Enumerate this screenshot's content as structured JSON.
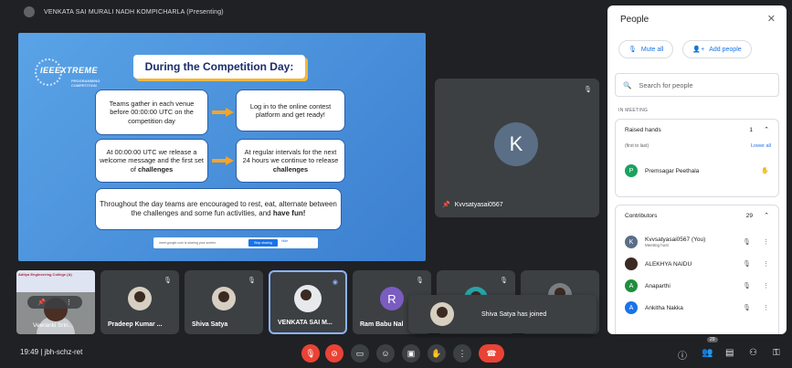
{
  "presenter_bar": {
    "text": "VENKATA SAI MURALI NADH KOMPICHARLA (Presenting)"
  },
  "slide": {
    "logo_text": "IEEEXTREME",
    "logo_sub": "PROGRAMMING COMPETITION",
    "title": "During the Competition Day:",
    "box1": "Teams gather in each venue before 00:00:00 UTC on the competition day",
    "box2": "Log in to the online contest platform and get ready!",
    "box3_text": "At 00:00:00 UTC we release a welcome message and the first set of",
    "box3_bold": "challenges",
    "box4_text": "At regular intervals for the next 24 hours we continue to release",
    "box4_bold": "challenges",
    "box5_text": "Throughout the day teams are encouraged to rest, eat, alternate between the challenges and some fun activities, and",
    "box5_bold": "have fun!",
    "share_text": "meet.google.com is sharing your screen.",
    "stop_label": "Stop sharing",
    "hide_label": "Hide"
  },
  "big_tile": {
    "initial": "K",
    "name": "Kvvsatyasai0567"
  },
  "camera_tile": {
    "banner": "Aditya Engineering College (A)",
    "name": "Veeranki Srin..."
  },
  "tiles": [
    {
      "name": "Pradeep Kumar ..."
    },
    {
      "name": "Shiva Satya"
    },
    {
      "name": "VENKATA SAI M..."
    },
    {
      "name": "Ram Babu Nal",
      "initial": "R"
    }
  ],
  "toast": {
    "text": "Shiva Satya has joined"
  },
  "bottom": {
    "meeting_info": "19:49 | jbh-schz-ret",
    "participant_badge": "29"
  },
  "panel": {
    "title": "People",
    "mute_all": "Mute all",
    "add_people": "Add people",
    "search_placeholder": "Search for people",
    "in_meeting": "IN MEETING",
    "raised_hands": {
      "label": "Raised hands",
      "count": "1",
      "order": "(first to last)",
      "lower_all": "Lower all",
      "person": "Premsagar Peethala",
      "initial": "P"
    },
    "contributors": {
      "label": "Contributors",
      "count": "29",
      "people": [
        {
          "name": "Kvvsatyasai0567 (You)",
          "sub": "Meeting host",
          "initial": "K",
          "color": "#5a6e86"
        },
        {
          "name": "ALEKHYA NAIDU",
          "initial": "",
          "color": "#3a2a22"
        },
        {
          "name": "Anaparthi",
          "initial": "A",
          "color": "#1e8e3e"
        },
        {
          "name": "Ankitha Nakka",
          "initial": "A",
          "color": "#1a73e8"
        }
      ]
    }
  },
  "colors": {
    "accent": "#1a73e8",
    "danger": "#ea4335",
    "slide_bg": "#4a90e2"
  }
}
